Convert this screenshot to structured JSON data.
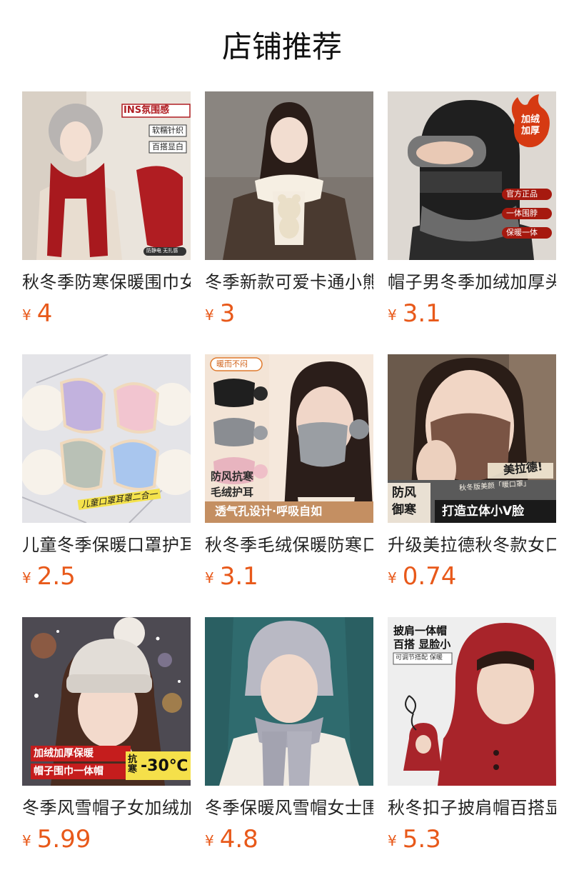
{
  "title": "店铺推荐",
  "currency": "¥",
  "accent_color": "#e8591a",
  "products": [
    {
      "name": "秋冬季防寒保暖围巾女",
      "price": "4",
      "image_texts": [
        "INS氛围感",
        "软糯针织",
        "百搭显白",
        "防静电 无扎感"
      ]
    },
    {
      "name": "冬季新款可爱卡通小熊围巾",
      "price": "3",
      "image_texts": []
    },
    {
      "name": "帽子男冬季加绒加厚头套",
      "price": "3.1",
      "image_texts": [
        "加绒加厚",
        "官方正品",
        "一体围脖",
        "保暖一体"
      ]
    },
    {
      "name": "儿童冬季保暖口罩护耳二合一",
      "price": "2.5",
      "image_texts": [
        "儿童口罩耳罩二合一"
      ]
    },
    {
      "name": "秋冬季毛绒保暖防寒口罩",
      "price": "3.1",
      "image_texts": [
        "暖而不闷",
        "防风抗寒",
        "毛绒护耳",
        "透气孔设计·呼吸自如"
      ]
    },
    {
      "name": "升级美拉德秋冬款女口罩",
      "price": "0.74",
      "image_texts": [
        "美拉德!",
        "秋冬版美颜「暖口罩」",
        "防风",
        "御寒",
        "打造立体小V脸"
      ]
    },
    {
      "name": "冬季风雪帽子女加绒加厚",
      "price": "5.99",
      "image_texts": [
        "加绒加厚保暖",
        "帽子围巾一体帽",
        "抗寒",
        "-30℃"
      ]
    },
    {
      "name": "冬季保暖风雪帽女士围巾",
      "price": "4.8",
      "image_texts": []
    },
    {
      "name": "秋冬扣子披肩帽百搭显脸小",
      "price": "5.3",
      "image_texts": [
        "披肩一体帽",
        "百搭 显脸小",
        "可调节搭配 保暖"
      ]
    }
  ]
}
